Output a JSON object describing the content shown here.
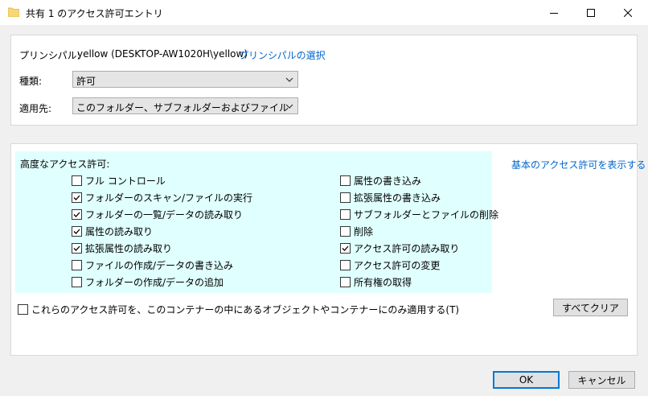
{
  "window": {
    "title": "共有 1 のアクセス許可エントリ",
    "controls": {
      "minimize_icon": "minimize-icon",
      "maximize_icon": "maximize-icon",
      "close_icon": "close-icon"
    }
  },
  "principal": {
    "label": "プリンシパル:",
    "value": "yellow (DESKTOP-AW1020H\\yellow)",
    "select_link": "プリンシパルの選択"
  },
  "type": {
    "label": "種類:",
    "value": "許可"
  },
  "applies_to": {
    "label": "適用先:",
    "value": "このフォルダー、サブフォルダーおよびファイル"
  },
  "advanced": {
    "heading": "高度なアクセス許可:",
    "show_basic_link": "基本のアクセス許可を表示する",
    "left": [
      {
        "label": "フル コントロール",
        "checked": false
      },
      {
        "label": "フォルダーのスキャン/ファイルの実行",
        "checked": true
      },
      {
        "label": "フォルダーの一覧/データの読み取り",
        "checked": true
      },
      {
        "label": "属性の読み取り",
        "checked": true
      },
      {
        "label": "拡張属性の読み取り",
        "checked": true
      },
      {
        "label": "ファイルの作成/データの書き込み",
        "checked": false
      },
      {
        "label": "フォルダーの作成/データの追加",
        "checked": false
      }
    ],
    "right": [
      {
        "label": "属性の書き込み",
        "checked": false
      },
      {
        "label": "拡張属性の書き込み",
        "checked": false
      },
      {
        "label": "サブフォルダーとファイルの削除",
        "checked": false
      },
      {
        "label": "削除",
        "checked": false
      },
      {
        "label": "アクセス許可の読み取り",
        "checked": true
      },
      {
        "label": "アクセス許可の変更",
        "checked": false
      },
      {
        "label": "所有権の取得",
        "checked": false
      }
    ]
  },
  "only_apply": {
    "label": "これらのアクセス許可を、このコンテナーの中にあるオブジェクトやコンテナーにのみ適用する(T)",
    "checked": false
  },
  "buttons": {
    "clear_all": "すべてクリア",
    "ok": "OK",
    "cancel": "キャンセル"
  },
  "colors": {
    "highlight_bg": "#e0ffff",
    "link": "#0066cc",
    "accent": "#0078d7",
    "folder": "#f8d775"
  }
}
